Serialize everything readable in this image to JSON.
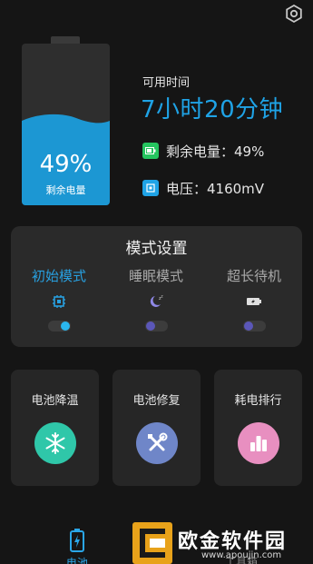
{
  "header": {
    "settings_icon": "gear-icon"
  },
  "battery": {
    "percent_text": "49%",
    "level": 0.49,
    "level_label": "剩余电量",
    "fill_color": "#1c97d3"
  },
  "available": {
    "label": "可用时间",
    "time": "7小时20分钟"
  },
  "info": {
    "remaining": {
      "text": "剩余电量：49%",
      "icon": "battery-level-icon",
      "color": "#25c45f"
    },
    "voltage": {
      "text": "电压：4160mV",
      "icon": "voltage-icon",
      "color": "#1fa3e6"
    }
  },
  "mode_panel": {
    "title": "模式设置",
    "modes": [
      {
        "label": "初始模式",
        "icon": "chip-icon",
        "active": true,
        "toggle_on": true
      },
      {
        "label": "睡眠模式",
        "icon": "moon-sleep-icon",
        "active": false,
        "toggle_on": false
      },
      {
        "label": "超长待机",
        "icon": "battery-boost-icon",
        "active": false,
        "toggle_on": false
      }
    ]
  },
  "tools": [
    {
      "label": "电池降温",
      "icon": "snowflake-icon",
      "color": "#2fc7a9"
    },
    {
      "label": "电池修复",
      "icon": "wrench-icon",
      "color": "#6f86c8"
    },
    {
      "label": "耗电排行",
      "icon": "bar-chart-icon",
      "color": "#e88fc0"
    }
  ],
  "bottom_nav": {
    "battery_label": "电池",
    "tools_label": "工具箱"
  },
  "watermark": {
    "title": "欧金软件园",
    "url": "www.apoujin.com"
  },
  "colors": {
    "accent": "#1fa3e6",
    "panel": "#2a2a2a",
    "background": "#151515"
  }
}
